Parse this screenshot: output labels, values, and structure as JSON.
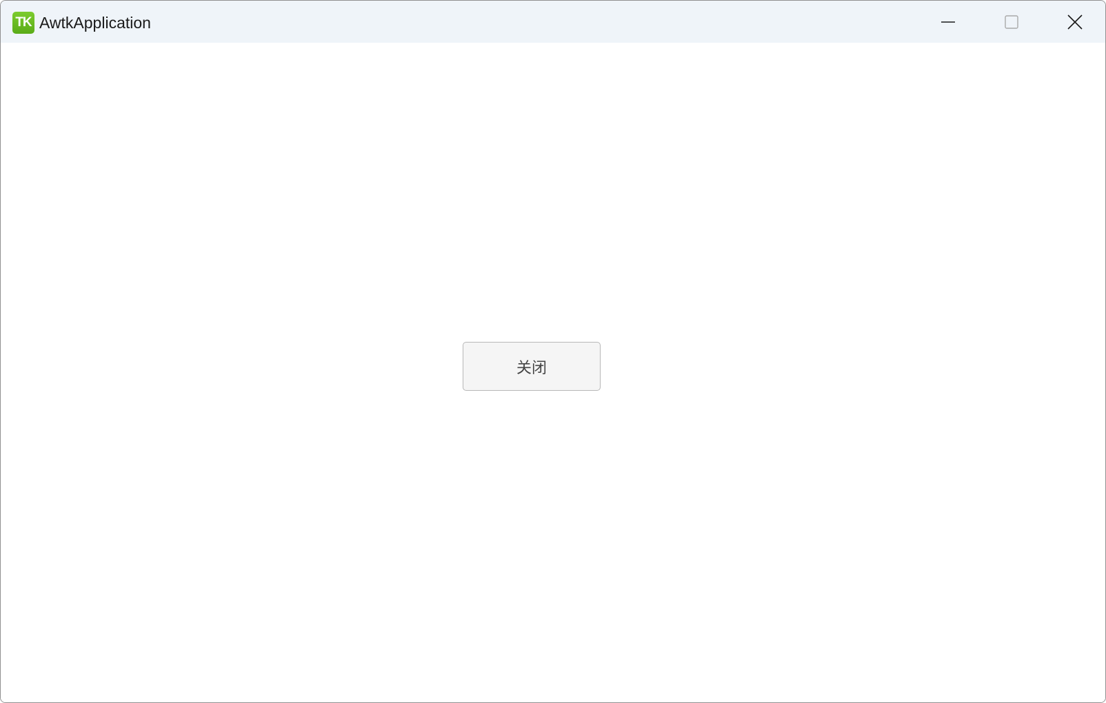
{
  "window": {
    "title": "AwtkApplication",
    "icon_text": "TK",
    "icon_name": "awtk-app-icon",
    "controls": {
      "minimize_icon": "minimize-icon",
      "maximize_icon": "maximize-icon",
      "close_icon": "close-icon"
    }
  },
  "main": {
    "close_button_label": "关闭"
  },
  "colors": {
    "titlebar_bg": "#eff4f9",
    "icon_green": "#6abd23",
    "button_bg": "#f5f5f5",
    "button_border": "#b7b7b7"
  }
}
